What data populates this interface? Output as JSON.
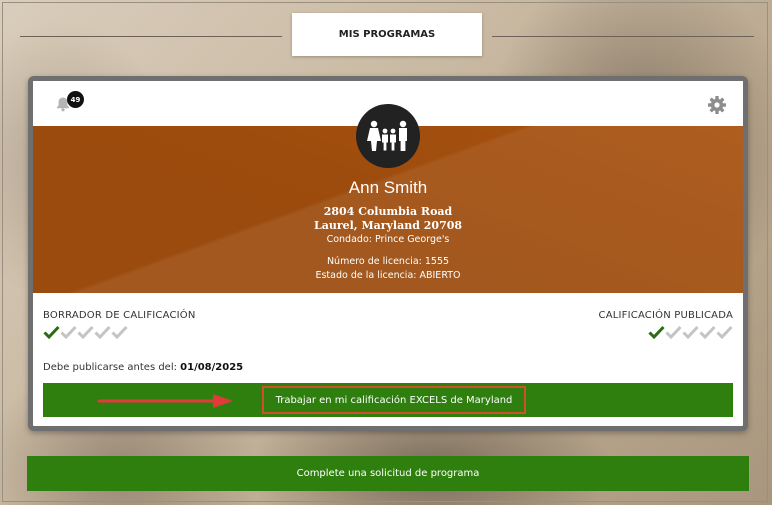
{
  "header": {
    "title": "MIS PROGRAMAS"
  },
  "notifications": {
    "count": "49",
    "icon": "bell-icon"
  },
  "settings": {
    "icon": "gear-icon"
  },
  "program": {
    "name": "Ann Smith",
    "address_line1": "2804 Columbia Road",
    "address_line2": "Laurel, Maryland 20708",
    "county": "Condado: Prince George's",
    "license_number": "Número de licencia: 1555",
    "license_status": "Estado de la licencia: ABIERTO"
  },
  "rating": {
    "draft_label": "BORRADOR DE CALIFICACIÓN",
    "published_label": "CALIFICACIÓN PUBLICADA",
    "draft_checks": {
      "filled": 1,
      "total": 5
    },
    "published_checks": {
      "filled": 1,
      "total": 5
    },
    "due_label": "Debe publicarse antes del: ",
    "due_date": "01/08/2025"
  },
  "actions": {
    "work_label": "Trabajar en mi calificación EXCELS de Maryland",
    "apply_label": "Complete una solicitud de programa"
  },
  "colors": {
    "banner": "#a8510e",
    "green": "#2f7f0e",
    "check_active": "#2a6b14",
    "check_inactive": "#c4c4c4",
    "highlight": "#d0502e",
    "arrow": "#e03a3a"
  }
}
